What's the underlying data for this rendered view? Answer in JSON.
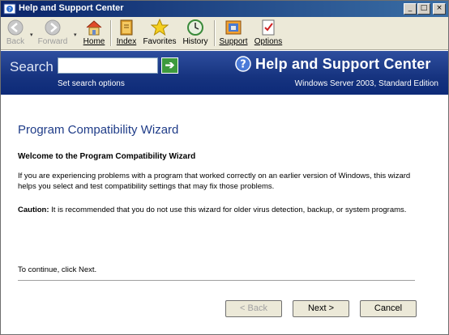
{
  "window": {
    "title": "Help and Support Center",
    "controls": {
      "minimize": "_",
      "maximize": "□",
      "close": "×"
    }
  },
  "toolbar": {
    "items": [
      {
        "label": "Back",
        "icon": "back-arrow-icon",
        "enabled": false
      },
      {
        "label": "Forward",
        "icon": "forward-arrow-icon",
        "enabled": false
      },
      {
        "label": "Home",
        "icon": "home-icon",
        "enabled": true
      },
      {
        "label": "Index",
        "icon": "index-book-icon",
        "enabled": true
      },
      {
        "label": "Favorites",
        "icon": "star-icon",
        "enabled": true
      },
      {
        "label": "History",
        "icon": "clock-icon",
        "enabled": true
      },
      {
        "label": "Support",
        "icon": "support-icon",
        "enabled": true
      },
      {
        "label": "Options",
        "icon": "options-icon",
        "enabled": true
      }
    ],
    "dropdown_glyph": "▾"
  },
  "header": {
    "search_label": "Search",
    "search_value": "",
    "search_go_glyph": "➔",
    "search_options": "Set search options",
    "title": "Help and Support Center",
    "edition": "Windows Server 2003, Standard Edition",
    "colors": {
      "band": "#16337f",
      "accent": "#3d9a3d"
    }
  },
  "content": {
    "wizard_title": "Program Compatibility Wizard",
    "welcome": "Welcome to the Program Compatibility Wizard",
    "description": "If you are experiencing problems with a program that worked correctly on an earlier version of Windows, this wizard helps you select and test compatibility settings that may fix those problems.",
    "caution_label": "Caution:",
    "caution_text": " It is recommended that you do not use this wizard for older virus detection, backup, or system programs.",
    "continue": "To continue, click Next."
  },
  "buttons": {
    "back": "< Back",
    "next": "Next >",
    "cancel": "Cancel"
  }
}
